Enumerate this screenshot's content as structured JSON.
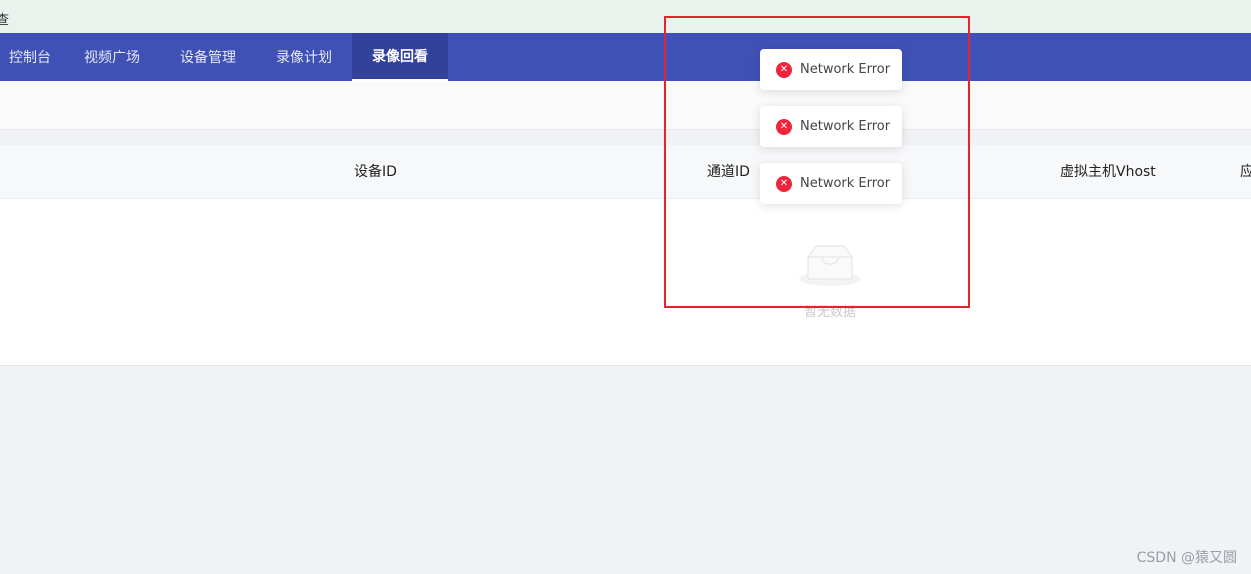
{
  "topbar": {
    "partial_text": "查"
  },
  "nav": {
    "items": [
      {
        "label": "控制台"
      },
      {
        "label": "视频广场"
      },
      {
        "label": "设备管理"
      },
      {
        "label": "录像计划"
      },
      {
        "label": "录像回看"
      }
    ],
    "active": "录像回看"
  },
  "table": {
    "columns": [
      "设备ID",
      "通道ID",
      "虚拟主机Vhost",
      "应"
    ],
    "empty_text": "暂无数据"
  },
  "toasts": [
    {
      "message": "Network Error"
    },
    {
      "message": "Network Error"
    },
    {
      "message": "Network Error"
    }
  ],
  "watermark": "CSDN @猿又圆",
  "colors": {
    "nav_bg": "#3f51b5",
    "nav_active_bg": "#32419a",
    "error_icon": "#f0243b",
    "highlight_border": "#e0262a"
  }
}
